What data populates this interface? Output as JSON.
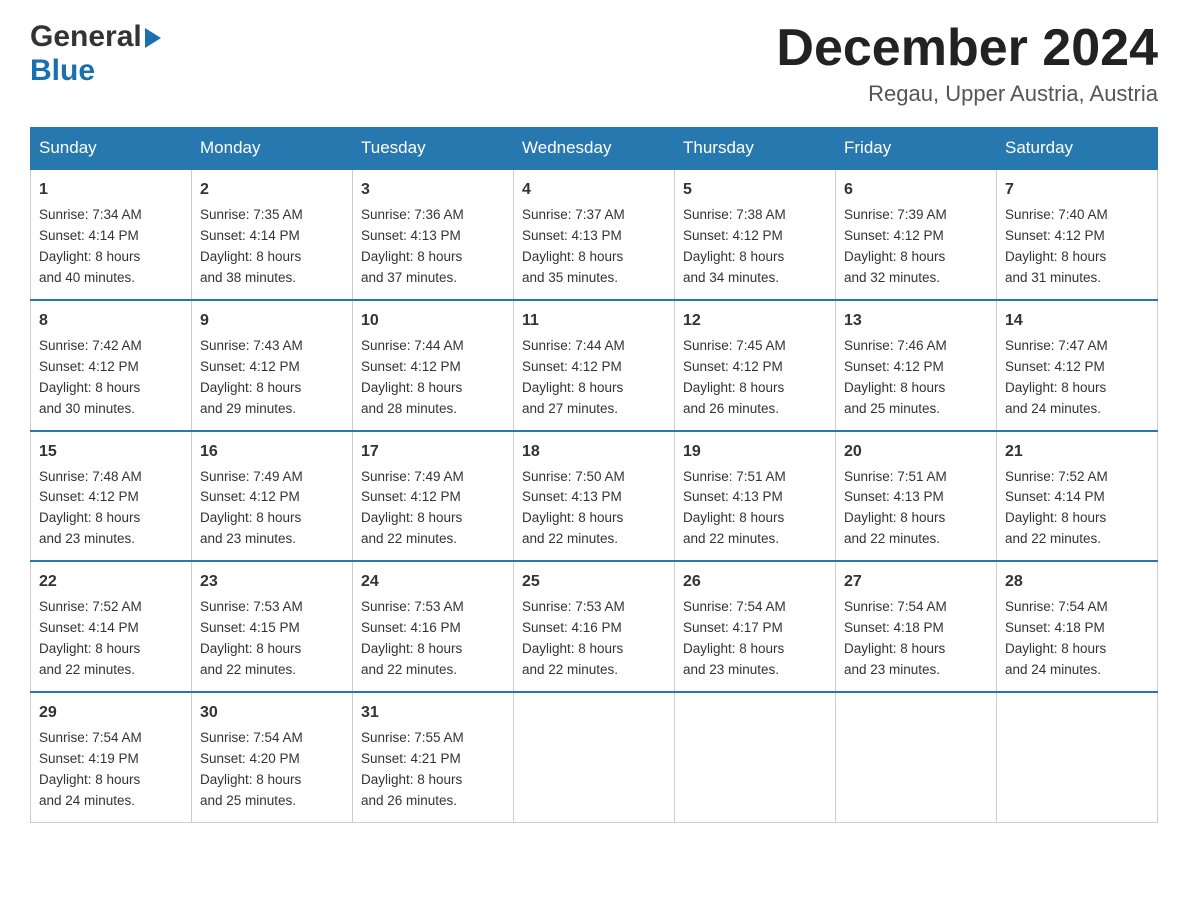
{
  "header": {
    "logo_general": "General",
    "logo_blue": "Blue",
    "month_title": "December 2024",
    "location": "Regau, Upper Austria, Austria"
  },
  "weekdays": [
    "Sunday",
    "Monday",
    "Tuesday",
    "Wednesday",
    "Thursday",
    "Friday",
    "Saturday"
  ],
  "weeks": [
    [
      {
        "day": "1",
        "sunrise": "7:34 AM",
        "sunset": "4:14 PM",
        "daylight": "8 hours and 40 minutes."
      },
      {
        "day": "2",
        "sunrise": "7:35 AM",
        "sunset": "4:14 PM",
        "daylight": "8 hours and 38 minutes."
      },
      {
        "day": "3",
        "sunrise": "7:36 AM",
        "sunset": "4:13 PM",
        "daylight": "8 hours and 37 minutes."
      },
      {
        "day": "4",
        "sunrise": "7:37 AM",
        "sunset": "4:13 PM",
        "daylight": "8 hours and 35 minutes."
      },
      {
        "day": "5",
        "sunrise": "7:38 AM",
        "sunset": "4:12 PM",
        "daylight": "8 hours and 34 minutes."
      },
      {
        "day": "6",
        "sunrise": "7:39 AM",
        "sunset": "4:12 PM",
        "daylight": "8 hours and 32 minutes."
      },
      {
        "day": "7",
        "sunrise": "7:40 AM",
        "sunset": "4:12 PM",
        "daylight": "8 hours and 31 minutes."
      }
    ],
    [
      {
        "day": "8",
        "sunrise": "7:42 AM",
        "sunset": "4:12 PM",
        "daylight": "8 hours and 30 minutes."
      },
      {
        "day": "9",
        "sunrise": "7:43 AM",
        "sunset": "4:12 PM",
        "daylight": "8 hours and 29 minutes."
      },
      {
        "day": "10",
        "sunrise": "7:44 AM",
        "sunset": "4:12 PM",
        "daylight": "8 hours and 28 minutes."
      },
      {
        "day": "11",
        "sunrise": "7:44 AM",
        "sunset": "4:12 PM",
        "daylight": "8 hours and 27 minutes."
      },
      {
        "day": "12",
        "sunrise": "7:45 AM",
        "sunset": "4:12 PM",
        "daylight": "8 hours and 26 minutes."
      },
      {
        "day": "13",
        "sunrise": "7:46 AM",
        "sunset": "4:12 PM",
        "daylight": "8 hours and 25 minutes."
      },
      {
        "day": "14",
        "sunrise": "7:47 AM",
        "sunset": "4:12 PM",
        "daylight": "8 hours and 24 minutes."
      }
    ],
    [
      {
        "day": "15",
        "sunrise": "7:48 AM",
        "sunset": "4:12 PM",
        "daylight": "8 hours and 23 minutes."
      },
      {
        "day": "16",
        "sunrise": "7:49 AM",
        "sunset": "4:12 PM",
        "daylight": "8 hours and 23 minutes."
      },
      {
        "day": "17",
        "sunrise": "7:49 AM",
        "sunset": "4:12 PM",
        "daylight": "8 hours and 22 minutes."
      },
      {
        "day": "18",
        "sunrise": "7:50 AM",
        "sunset": "4:13 PM",
        "daylight": "8 hours and 22 minutes."
      },
      {
        "day": "19",
        "sunrise": "7:51 AM",
        "sunset": "4:13 PM",
        "daylight": "8 hours and 22 minutes."
      },
      {
        "day": "20",
        "sunrise": "7:51 AM",
        "sunset": "4:13 PM",
        "daylight": "8 hours and 22 minutes."
      },
      {
        "day": "21",
        "sunrise": "7:52 AM",
        "sunset": "4:14 PM",
        "daylight": "8 hours and 22 minutes."
      }
    ],
    [
      {
        "day": "22",
        "sunrise": "7:52 AM",
        "sunset": "4:14 PM",
        "daylight": "8 hours and 22 minutes."
      },
      {
        "day": "23",
        "sunrise": "7:53 AM",
        "sunset": "4:15 PM",
        "daylight": "8 hours and 22 minutes."
      },
      {
        "day": "24",
        "sunrise": "7:53 AM",
        "sunset": "4:16 PM",
        "daylight": "8 hours and 22 minutes."
      },
      {
        "day": "25",
        "sunrise": "7:53 AM",
        "sunset": "4:16 PM",
        "daylight": "8 hours and 22 minutes."
      },
      {
        "day": "26",
        "sunrise": "7:54 AM",
        "sunset": "4:17 PM",
        "daylight": "8 hours and 23 minutes."
      },
      {
        "day": "27",
        "sunrise": "7:54 AM",
        "sunset": "4:18 PM",
        "daylight": "8 hours and 23 minutes."
      },
      {
        "day": "28",
        "sunrise": "7:54 AM",
        "sunset": "4:18 PM",
        "daylight": "8 hours and 24 minutes."
      }
    ],
    [
      {
        "day": "29",
        "sunrise": "7:54 AM",
        "sunset": "4:19 PM",
        "daylight": "8 hours and 24 minutes."
      },
      {
        "day": "30",
        "sunrise": "7:54 AM",
        "sunset": "4:20 PM",
        "daylight": "8 hours and 25 minutes."
      },
      {
        "day": "31",
        "sunrise": "7:55 AM",
        "sunset": "4:21 PM",
        "daylight": "8 hours and 26 minutes."
      },
      null,
      null,
      null,
      null
    ]
  ],
  "labels": {
    "sunrise": "Sunrise:",
    "sunset": "Sunset:",
    "daylight": "Daylight:"
  }
}
